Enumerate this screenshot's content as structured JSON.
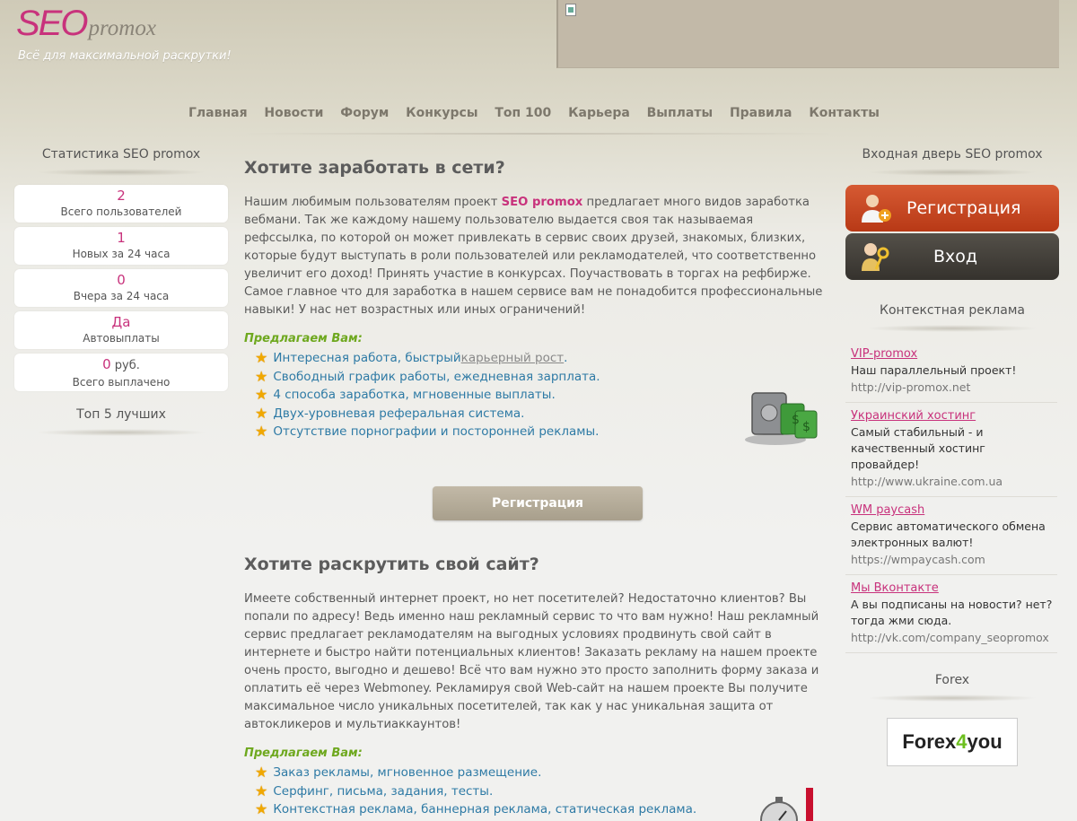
{
  "header": {
    "logo_seo": "SEO",
    "logo_promox": "promox",
    "tagline": "Всё для максимальной раскрутки!"
  },
  "nav": [
    "Главная",
    "Новости",
    "Форум",
    "Конкурсы",
    "Топ 100",
    "Карьера",
    "Выплаты",
    "Правила",
    "Контакты"
  ],
  "left": {
    "title": "Статистика SEO promox",
    "stats": [
      {
        "value": "2",
        "unit": "",
        "label": "Всего пользователей"
      },
      {
        "value": "1",
        "unit": "",
        "label": "Новых за 24 часа"
      },
      {
        "value": "0",
        "unit": "",
        "label": "Вчера за 24 часа"
      },
      {
        "value": "Да",
        "unit": "",
        "label": "Автовыплаты"
      },
      {
        "value": "0",
        "unit": " руб.",
        "label": "Всего выплачено"
      }
    ],
    "top5_title": "Топ 5 лучших"
  },
  "main": {
    "s1": {
      "title": "Хотите заработать в сети?",
      "para_start": "Нашим любимым пользователям проект ",
      "brand": "SEO promox",
      "para_rest": " предлагает много видов заработка вебмани. Так же каждому нашему пользователю выдается своя так называемая рефссылка, по которой он может привлекать в сервис своих друзей, знакомых, близких, которые будут выступать в роли пользователей или рекламодателей, что соответственно увеличит его доход! Принять участие в конкурсах. Поучаствовать в торгах на рефбирже. Самое главное что для заработка в нашем сервисе вам не понадобится профессиональные навыки! У нас нет возрастных или иных ограничений!",
      "offer": "Предлагаем Вам:",
      "item1_a": "Интересная работа, быстрый ",
      "item1_b": "карьерный рост",
      "item1_c": ".",
      "items": [
        "Свободный график работы, ежедневная зарплата.",
        "4 способа заработка, мгновенные выплаты.",
        "Двух-уровневая реферальная система.",
        "Отсутствие порнографии и посторонней рекламы."
      ],
      "button": "Регистрация"
    },
    "s2": {
      "title": "Хотите раскрутить свой сайт?",
      "para": "Имеете собственный интернет проект, но нет посетителей? Недостаточно клиентов? Вы попали по адресу! Ведь именно наш рекламный сервис то что вам нужно! Наш рекламный сервис предлагает рекламодателям на выгодных условиях продвинуть свой сайт в интернете и быстро найти потенциальных клиентов! Заказать рекламу на нашем проекте очень просто, выгодно и дешево! Всё что вам нужно это просто заполнить форму заказа и оплатить её через Webmoney. Рекламируя свой Web-сайт на нашем проекте Вы получите максимальное число уникальных посетителей, так как у нас уникальная защита от автокликеров и мультиаккаунтов!",
      "offer": "Предлагаем Вам:",
      "items": [
        "Заказ рекламы, мгновенное размещение.",
        "Серфинг, письма, задания, тесты.",
        "Контекстная реклама, баннерная реклама, статическая реклама."
      ]
    }
  },
  "right": {
    "title": "Входная дверь SEO promox",
    "register": "Регистрация",
    "login": "Вход",
    "ads_title": "Контекстная реклама",
    "ads": [
      {
        "title": "VIP-promox",
        "desc": "Наш параллельный проект!",
        "url": "http://vip-promox.net"
      },
      {
        "title": "Украинский хостинг",
        "desc": "Самый стабильный - и качественный хостинг провайдер!",
        "url": "http://www.ukraine.com.ua"
      },
      {
        "title": "WM paycash",
        "desc": "Сервис автоматического обмена электронных валют!",
        "url": "https://wmpaycash.com"
      },
      {
        "title": "Мы Вконтакте",
        "desc": "А вы подписаны на новости? нет? тогда жми сюда.",
        "url": "http://vk.com/company_seopromox"
      }
    ],
    "forex_title": "Forex",
    "forex_a": "Forex",
    "forex_b": "4",
    "forex_c": "you"
  }
}
